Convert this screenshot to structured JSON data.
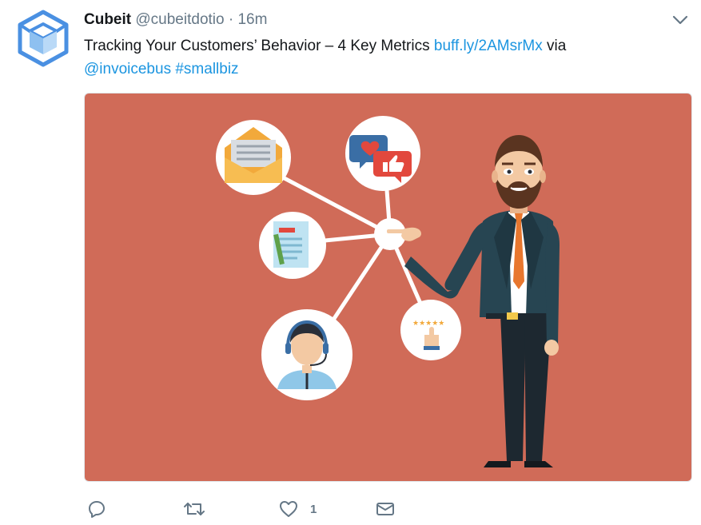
{
  "tweet": {
    "display_name": "Cubeit",
    "handle": "@cubeitdotio",
    "separator": "·",
    "timestamp": "16m",
    "text_main": "Tracking Your Customers’ Behavior – 4 Key Metrics ",
    "link": "buff.ly/2AMsrMx",
    "text_via": " via",
    "mention": "@invoicebus",
    "hashtag": "#smallbiz"
  },
  "media": {
    "background_color": "#d06b58",
    "rating_text": "★★★★★"
  },
  "actions": {
    "like_count": "1"
  },
  "colors": {
    "link": "#1b95e0",
    "text": "#14171a",
    "muted": "#657786",
    "avatar_blue": "#4a90e2"
  },
  "icons": {
    "avatar": "cube-logo-icon",
    "menu": "chevron-down-icon",
    "reply": "reply-icon",
    "retweet": "retweet-icon",
    "like": "heart-icon",
    "dm": "envelope-icon"
  }
}
